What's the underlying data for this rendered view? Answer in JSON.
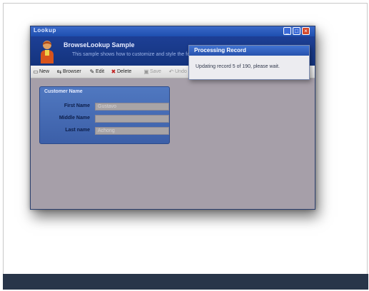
{
  "window": {
    "title": "Lookup",
    "buttons": {
      "minimize": "_",
      "maximize": "□",
      "close": "×"
    }
  },
  "banner": {
    "title": "BrowseLookup Sample",
    "subtitle": "This sample shows how to customize and style the form"
  },
  "toolbar": {
    "items": [
      {
        "label": "New",
        "icon": "new-icon"
      },
      {
        "label": "Browser",
        "icon": "browse-icon"
      },
      {
        "label": "Edit",
        "icon": "edit-icon"
      },
      {
        "label": "Delete",
        "icon": "delete-icon"
      },
      {
        "label": "Save",
        "icon": "save-icon",
        "disabled": true
      },
      {
        "label": "Undo",
        "icon": "undo-icon",
        "disabled": true
      }
    ]
  },
  "customer_group": {
    "title": "Customer Name",
    "fields": [
      {
        "label": "First Name",
        "value": "Gustavo"
      },
      {
        "label": "Middle Name",
        "value": ""
      },
      {
        "label": "Last name",
        "value": "Achong"
      }
    ]
  },
  "popup": {
    "title": "Processing Record",
    "message": "Updating record 5 of 190, please wait."
  },
  "colors": {
    "title_bar": "#1e4fb0",
    "banner": "#14347e",
    "body": "#a69fa9",
    "footer_band": "#283549"
  }
}
